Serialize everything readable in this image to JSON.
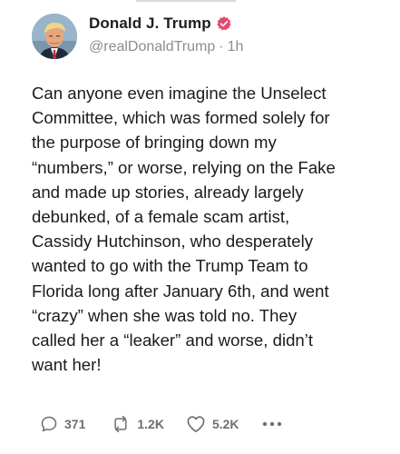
{
  "post": {
    "author": {
      "display_name": "Donald J. Trump",
      "handle": "@realDonaldTrump",
      "time_ago": "1h",
      "separator": "·",
      "verified": true
    },
    "body": "Can anyone even imagine the Unselect\nCommittee, which was formed solely for\nthe purpose of bringing down my\n“numbers,” or worse, relying on the Fake\nand made up stories, already largely\ndebunked, of a female scam artist,\nCassidy Hutchinson, who desperately\nwanted to go with the Trump Team to\nFlorida long after January 6th, and went\n“crazy” when she was told no. They\ncalled her a “leaker” and worse, didn’t\nwant her!",
    "stats": {
      "replies": "371",
      "retruths": "1.2K",
      "likes": "5.2K"
    }
  },
  "icons": {
    "verified": "verified-badge-icon",
    "reply": "speech-bubble-icon",
    "retruth": "repost-arrows-icon",
    "like": "heart-icon",
    "more": "ellipsis-icon"
  },
  "colors": {
    "verified_badge": "#e14b6d",
    "text": "#1b1b1b",
    "muted": "#8d8d8d",
    "action_gray": "#6e6e6e"
  }
}
